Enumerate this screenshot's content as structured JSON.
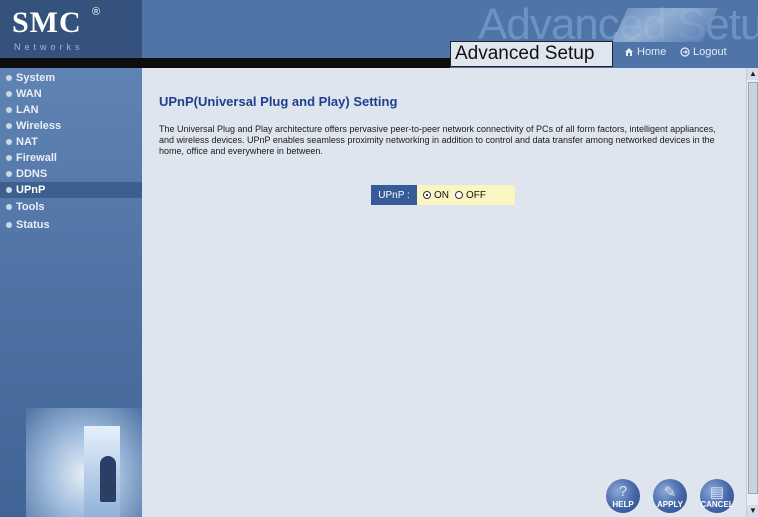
{
  "header": {
    "logo_text": "SMC",
    "logo_reg": "®",
    "logo_subtext": "Networks",
    "background_title": "Advanced Setup",
    "title": "Advanced Setup",
    "home_label": "Home",
    "logout_label": "Logout",
    "home_icon": "home-icon",
    "logout_icon": "logout-icon"
  },
  "sidebar": {
    "items": [
      {
        "label": "System",
        "active": false
      },
      {
        "label": "WAN",
        "active": false
      },
      {
        "label": "LAN",
        "active": false
      },
      {
        "label": "Wireless",
        "active": false
      },
      {
        "label": "NAT",
        "active": false
      },
      {
        "label": "Firewall",
        "active": false
      },
      {
        "label": "DDNS",
        "active": false
      },
      {
        "label": "UPnP",
        "active": true
      },
      {
        "label": "Tools",
        "active": false
      },
      {
        "label": "Status",
        "active": false
      }
    ]
  },
  "main": {
    "title": "UPnP(Universal Plug and Play) Setting",
    "description": "The Universal Plug and Play architecture offers pervasive peer-to-peer network connectivity of PCs of all form factors, intelligent appliances, and wireless devices. UPnP enables seamless proximity networking in addition to control and data transfer among networked devices in the home, office and everywhere in between.",
    "upnp": {
      "label": "UPnP :",
      "options": [
        {
          "label": "ON",
          "checked": true
        },
        {
          "label": "OFF",
          "checked": false
        }
      ]
    },
    "buttons": {
      "help": "HELP",
      "apply": "APPLY",
      "cancel": "CANCEL"
    }
  },
  "colors": {
    "header_bg": "#4f75a8",
    "sidebar_bg": "#4e72a3",
    "main_bg": "#dfe5ee",
    "title_color": "#1f3f8c",
    "upnp_label_bg": "#375b97",
    "upnp_options_bg": "#fbf6c1"
  }
}
